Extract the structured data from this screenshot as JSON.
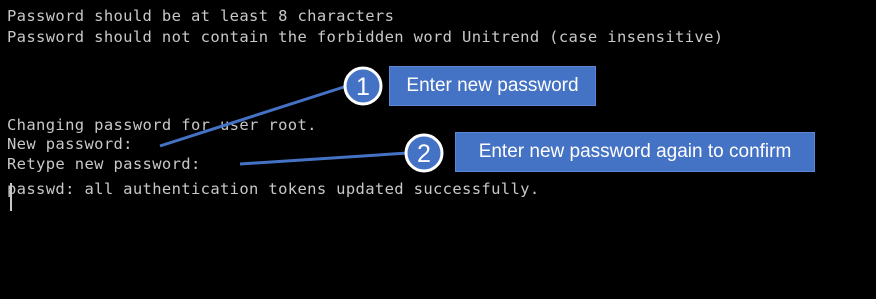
{
  "terminal": {
    "lines": [
      "Password should be at least 8 characters",
      "Password should not contain the forbidden word Unitrend (case insensitive)",
      "Changing password for user root.",
      "New password:",
      "Retype new password:",
      "passwd: all authentication tokens updated successfully."
    ]
  },
  "annotations": [
    {
      "number": "1",
      "text": "Enter new password"
    },
    {
      "number": "2",
      "text": "Enter new password again to confirm"
    }
  ],
  "colors": {
    "terminal_background": "#000000",
    "terminal_text": "#c8c8c8",
    "callout_fill": "#4472c4",
    "callout_text": "#ffffff"
  }
}
